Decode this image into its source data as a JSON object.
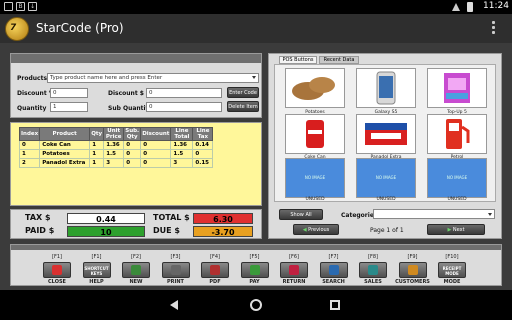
{
  "status": {
    "time": "11:24"
  },
  "app": {
    "title": "StarCode (Pro)",
    "logo_text": "7"
  },
  "form": {
    "products_label": "Products",
    "products_placeholder": "Type product name here and press Enter",
    "discount_pct_label": "Discount %",
    "discount_pct_value": "0",
    "discount_amt_label": "Discount $",
    "discount_amt_value": "0",
    "quantity_label": "Quantity",
    "quantity_value": "1",
    "sub_quantity_label": "Sub Quantity",
    "sub_quantity_value": "0",
    "enter_code_label": "Enter Code",
    "delete_item_label": "Delete Item"
  },
  "table": {
    "headers": [
      "Index",
      "Product",
      "Qty",
      "Unit Price",
      "Sub. Qty",
      "Discount",
      "Line Total",
      "Line Tax"
    ],
    "rows": [
      [
        "0",
        "Coke Can",
        "1",
        "1.36",
        "0",
        "0",
        "1.36",
        "0.14"
      ],
      [
        "1",
        "Potatoes",
        "1",
        "1.5",
        "0",
        "0",
        "1.5",
        "0"
      ],
      [
        "2",
        "Panadol Extra",
        "1",
        "3",
        "0",
        "0",
        "3",
        "0.15"
      ]
    ]
  },
  "totals": {
    "tax_label": "TAX $",
    "tax_value": "0.44",
    "total_label": "TOTAL $",
    "total_value": "6.30",
    "paid_label": "PAID $",
    "paid_value": "10",
    "due_label": "DUE $",
    "due_value": "-3.70",
    "colors": {
      "total": "#e03030",
      "paid": "#2ea02e",
      "due": "#e8a020"
    }
  },
  "pos": {
    "tabs": [
      "POS Buttons",
      "Recent Data"
    ],
    "tiles": [
      {
        "label": "Potatoes",
        "icon": "potato-icon"
      },
      {
        "label": "Galaxy S5",
        "icon": "phone-icon"
      },
      {
        "label": "Top-Up 5",
        "icon": "topup-card-icon"
      },
      {
        "label": "Coke Can",
        "icon": "coke-can-icon"
      },
      {
        "label": "Panadol Extra",
        "icon": "medicine-box-icon"
      },
      {
        "label": "Petrol",
        "icon": "fuel-pump-icon"
      },
      {
        "label": "UNUSED",
        "icon": "no-image-icon",
        "placeholder": "NO IMAGE"
      },
      {
        "label": "UNUSED",
        "icon": "no-image-icon",
        "placeholder": "NO IMAGE"
      },
      {
        "label": "UNUSED",
        "icon": "no-image-icon",
        "placeholder": "NO IMAGE"
      }
    ],
    "show_all": "Show All",
    "categories_label": "Categories",
    "previous": "Previous",
    "page_info": "Page 1 of 1",
    "next": "Next"
  },
  "fkeys": [
    {
      "key": "[F1]",
      "label": "CLOSE",
      "icon": "close-icon"
    },
    {
      "key": "[F1]",
      "label": "HELP",
      "icon": "shortcut-keys-icon",
      "icon_text": "SHORTCUT KEYS"
    },
    {
      "key": "[F2]",
      "label": "NEW",
      "icon": "new-icon"
    },
    {
      "key": "[F3]",
      "label": "PRINT",
      "icon": "printer-icon"
    },
    {
      "key": "[F4]",
      "label": "PDF",
      "icon": "pdf-icon"
    },
    {
      "key": "[F5]",
      "label": "PAY",
      "icon": "pay-icon"
    },
    {
      "key": "[F6]",
      "label": "RETURN",
      "icon": "return-icon"
    },
    {
      "key": "[F7]",
      "label": "SEARCH",
      "icon": "search-icon"
    },
    {
      "key": "[F8]",
      "label": "SALES",
      "icon": "sales-chart-icon"
    },
    {
      "key": "[F9]",
      "label": "CUSTOMERS",
      "icon": "customers-icon"
    },
    {
      "key": "[F10]",
      "label": "MODE",
      "icon": "receipt-mode-icon",
      "icon_text": "RECEIPT MODE"
    }
  ]
}
